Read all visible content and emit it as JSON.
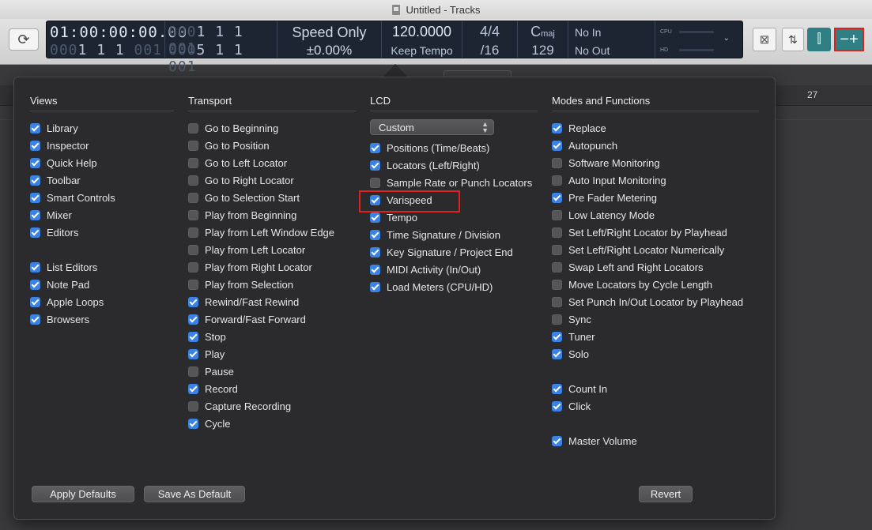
{
  "window": {
    "title": "Untitled - Tracks"
  },
  "lcd": {
    "position_time_dim": "",
    "position_time": "01:00:00:00.00",
    "position_beats_dim": "000",
    "position_beats": "1  1  1",
    "position_beats_tail": "001",
    "left_locator_dim": "000",
    "left_locator": "1  1  1",
    "left_locator_tail": "001",
    "right_locator_dim": "000",
    "right_locator": "5  1  1",
    "right_locator_tail": "001",
    "speed_mode": "Speed Only",
    "speed_value": "±0.00",
    "speed_unit": "%",
    "tempo": "120.0000",
    "tempo_mode": "Keep Tempo",
    "time_signature": "4/4",
    "division": "/16",
    "key": "C",
    "key_mode": "maj",
    "project_end": "129",
    "midi_in": "No In",
    "midi_out": "No Out",
    "cpu_label": "CPU",
    "hd_label": "HD"
  },
  "ruler": {
    "bar_number": "27"
  },
  "popover": {
    "columns": {
      "views": {
        "title": "Views",
        "items": [
          {
            "label": "Library",
            "checked": true
          },
          {
            "label": "Inspector",
            "checked": true
          },
          {
            "label": "Quick Help",
            "checked": true
          },
          {
            "label": "Toolbar",
            "checked": true
          },
          {
            "label": "Smart Controls",
            "checked": true
          },
          {
            "label": "Mixer",
            "checked": true
          },
          {
            "label": "Editors",
            "checked": true
          },
          null,
          {
            "label": "List Editors",
            "checked": true
          },
          {
            "label": "Note Pad",
            "checked": true
          },
          {
            "label": "Apple Loops",
            "checked": true
          },
          {
            "label": "Browsers",
            "checked": true
          }
        ]
      },
      "transport": {
        "title": "Transport",
        "items": [
          {
            "label": "Go to Beginning",
            "checked": false
          },
          {
            "label": "Go to Position",
            "checked": false
          },
          {
            "label": "Go to Left Locator",
            "checked": false
          },
          {
            "label": "Go to Right Locator",
            "checked": false
          },
          {
            "label": "Go to Selection Start",
            "checked": false
          },
          {
            "label": "Play from Beginning",
            "checked": false
          },
          {
            "label": "Play from Left Window Edge",
            "checked": false
          },
          {
            "label": "Play from Left Locator",
            "checked": false
          },
          {
            "label": "Play from Right Locator",
            "checked": false
          },
          {
            "label": "Play from Selection",
            "checked": false
          },
          {
            "label": "Rewind/Fast Rewind",
            "checked": true
          },
          {
            "label": "Forward/Fast Forward",
            "checked": true
          },
          {
            "label": "Stop",
            "checked": true
          },
          {
            "label": "Play",
            "checked": true
          },
          {
            "label": "Pause",
            "checked": false
          },
          {
            "label": "Record",
            "checked": true
          },
          {
            "label": "Capture Recording",
            "checked": false
          },
          {
            "label": "Cycle",
            "checked": true
          }
        ]
      },
      "lcd": {
        "title": "LCD",
        "select_value": "Custom",
        "items": [
          {
            "label": "Positions (Time/Beats)",
            "checked": true
          },
          {
            "label": "Locators (Left/Right)",
            "checked": true
          },
          {
            "label": "Sample Rate or Punch Locators",
            "checked": false
          },
          {
            "label": "Varispeed",
            "checked": true
          },
          {
            "label": "Tempo",
            "checked": true
          },
          {
            "label": "Time Signature / Division",
            "checked": true
          },
          {
            "label": "Key Signature / Project End",
            "checked": true
          },
          {
            "label": "MIDI Activity (In/Out)",
            "checked": true
          },
          {
            "label": "Load Meters (CPU/HD)",
            "checked": true
          }
        ]
      },
      "modes": {
        "title": "Modes and Functions",
        "items": [
          {
            "label": "Replace",
            "checked": true
          },
          {
            "label": "Autopunch",
            "checked": true
          },
          {
            "label": "Software Monitoring",
            "checked": false
          },
          {
            "label": "Auto Input Monitoring",
            "checked": false
          },
          {
            "label": "Pre Fader Metering",
            "checked": true
          },
          {
            "label": "Low Latency Mode",
            "checked": false
          },
          {
            "label": "Set Left/Right Locator by Playhead",
            "checked": false
          },
          {
            "label": "Set Left/Right Locator Numerically",
            "checked": false
          },
          {
            "label": "Swap Left and Right Locators",
            "checked": false
          },
          {
            "label": "Move Locators by Cycle Length",
            "checked": false
          },
          {
            "label": "Set Punch In/Out Locator by Playhead",
            "checked": false
          },
          {
            "label": "Sync",
            "checked": false
          },
          {
            "label": "Tuner",
            "checked": true
          },
          {
            "label": "Solo",
            "checked": true
          },
          null,
          {
            "label": "Count In",
            "checked": true
          },
          {
            "label": "Click",
            "checked": true
          },
          null,
          {
            "label": "Master Volume",
            "checked": true
          }
        ]
      }
    },
    "buttons": {
      "apply_defaults": "Apply Defaults",
      "save_as_default": "Save As Default",
      "revert": "Revert"
    }
  },
  "colors": {
    "checkbox_on": "#3a82e4",
    "highlight": "#e0201c",
    "accent_teal": "#2f7f85",
    "lcd_bg": "#1d2532"
  }
}
